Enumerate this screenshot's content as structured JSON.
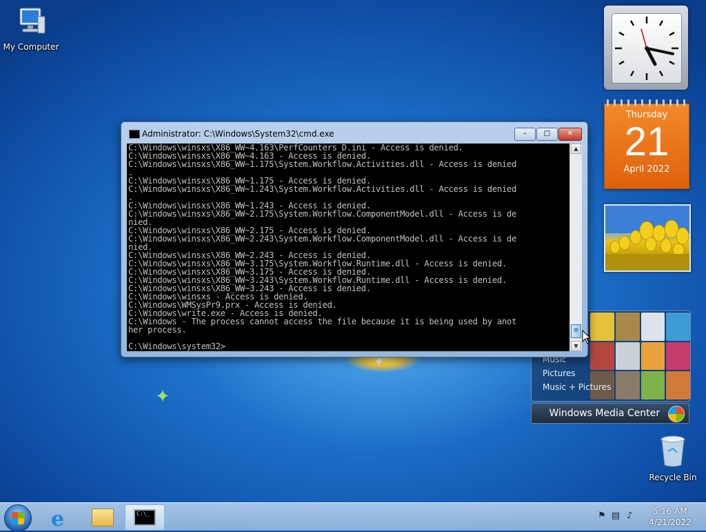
{
  "desktop": {
    "icons": {
      "my_computer": "My Computer",
      "recycle_bin": "Recycle Bin"
    }
  },
  "gadgets": {
    "calendar": {
      "weekday": "Thursday",
      "day": "21",
      "month_year": "April 2022"
    },
    "media_center": {
      "items": [
        "Music",
        "Pictures",
        "Music + Pictures"
      ],
      "banner": "Windows Media Center"
    }
  },
  "cmd_window": {
    "title": "Administrator: C:\\Windows\\System32\\cmd.exe",
    "buttons": {
      "minimize": "–",
      "maximize": "□",
      "close": "✕"
    },
    "lines": [
      "C:\\Windows\\winsxs\\X86_WW~4.163\\PerfCounters_D.ini - Access is denied.",
      "C:\\Windows\\winsxs\\X86_WW~4.163 - Access is denied.",
      "C:\\Windows\\winsxs\\X86_WW~1.175\\System.Workflow.Activities.dll - Access is denied",
      ".",
      "C:\\Windows\\winsxs\\X86_WW~1.175 - Access is denied.",
      "C:\\Windows\\winsxs\\X86_WW~1.243\\System.Workflow.Activities.dll - Access is denied",
      ".",
      "C:\\Windows\\winsxs\\X86_WW~1.243 - Access is denied.",
      "C:\\Windows\\winsxs\\X86_WW~2.175\\System.Workflow.ComponentModel.dll - Access is de",
      "nied.",
      "C:\\Windows\\winsxs\\X86_WW~2.175 - Access is denied.",
      "C:\\Windows\\winsxs\\X86_WW~2.243\\System.Workflow.ComponentModel.dll - Access is de",
      "nied.",
      "C:\\Windows\\winsxs\\X86_WW~2.243 - Access is denied.",
      "C:\\Windows\\winsxs\\X86_WW~3.175\\System.Workflow.Runtime.dll - Access is denied.",
      "C:\\Windows\\winsxs\\X86_WW~3.175 - Access is denied.",
      "C:\\Windows\\winsxs\\X86_WW~3.243\\System.Workflow.Runtime.dll - Access is denied.",
      "C:\\Windows\\winsxs\\X86_WW~3.243 - Access is denied.",
      "C:\\Windows\\winsxs - Access is denied.",
      "C:\\Windows\\WMSysPr9.prx - Access is denied.",
      "C:\\Windows\\write.exe - Access is denied.",
      "C:\\Windows - The process cannot access the file because it is being used by anot",
      "her process.",
      "",
      "C:\\Windows\\system32>"
    ]
  },
  "taskbar": {
    "cmd_icon_text": "C:\\_",
    "clock": {
      "time": "5:16 AM",
      "date": "4/21/2022"
    }
  },
  "colors": {
    "desktop_blue": "#1c6fc8",
    "calendar_orange": "#e0600c",
    "console_bg": "#000000",
    "console_text": "#c0c0c0"
  }
}
